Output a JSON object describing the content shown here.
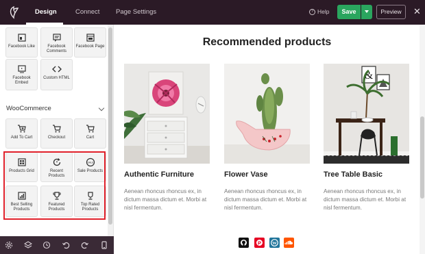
{
  "topbar": {
    "tabs": [
      {
        "label": "Design",
        "active": true
      },
      {
        "label": "Connect",
        "active": false
      },
      {
        "label": "Page Settings",
        "active": false
      }
    ],
    "help_label": "Help",
    "save_label": "Save",
    "preview_label": "Preview",
    "close_glyph": "✕"
  },
  "sidebar": {
    "top_blocks": [
      {
        "label": "Facebook Like",
        "icon": "facebook-like-icon"
      },
      {
        "label": "Facebook Comments",
        "icon": "facebook-comments-icon"
      },
      {
        "label": "Facebook Page",
        "icon": "facebook-page-icon"
      },
      {
        "label": "Facebook Embed",
        "icon": "facebook-embed-icon"
      },
      {
        "label": "Custom HTML",
        "icon": "code-icon"
      }
    ],
    "section_title": "WooCommerce",
    "woo_blocks": [
      {
        "label": "Add To Cart",
        "icon": "add-to-cart-icon"
      },
      {
        "label": "Checkout",
        "icon": "checkout-icon"
      },
      {
        "label": "Cart",
        "icon": "cart-icon"
      },
      {
        "label": "Products Grid",
        "icon": "products-grid-icon"
      },
      {
        "label": "Recent Products",
        "icon": "recent-products-icon"
      },
      {
        "label": "Sale Products",
        "icon": "sale-products-icon"
      },
      {
        "label": "Best Selling Products",
        "icon": "best-selling-icon"
      },
      {
        "label": "Featured Products",
        "icon": "trophy-icon"
      },
      {
        "label": "Top Rated Products",
        "icon": "top-rated-icon"
      }
    ],
    "highlight_color": "#e0202a"
  },
  "bottom_toolbar": {
    "icons": [
      "settings-icon",
      "layers-icon",
      "history-icon",
      "undo-icon",
      "redo-icon",
      "mobile-preview-icon"
    ]
  },
  "main": {
    "heading": "Recommended products",
    "products": [
      {
        "title": "Authentic Furniture",
        "description": "Aenean rhoncus rhoncus ex, in dictum massa dictum et. Morbi at nisl fermentum.",
        "image": "furniture-image"
      },
      {
        "title": "Flower Vase",
        "description": "Aenean rhoncus rhoncus ex, in dictum massa dictum et. Morbi at nisl fermentum.",
        "image": "flower-vase-image"
      },
      {
        "title": "Tree Table Basic",
        "description": "Aenean rhoncus rhoncus ex, in dictum massa dictum et. Morbi at nisl fermentum.",
        "image": "tree-table-image"
      }
    ],
    "social_icons": [
      {
        "name": "github-icon",
        "color": "#111111"
      },
      {
        "name": "pinterest-icon",
        "color": "#e60023"
      },
      {
        "name": "wordpress-icon",
        "color": "#21759b"
      },
      {
        "name": "soundcloud-icon",
        "color": "#ff5500"
      }
    ]
  },
  "colors": {
    "topbar_bg": "#2b1a26",
    "save_green": "#2aa55e",
    "bottombar_bg": "#3a2a36"
  }
}
